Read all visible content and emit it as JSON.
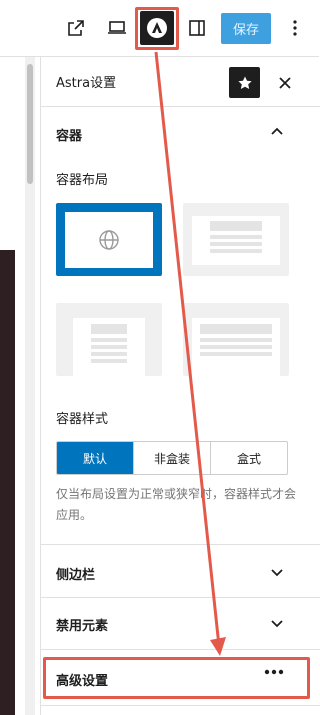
{
  "toolbar": {
    "icons": [
      "external-link-icon",
      "laptop-icon",
      "astra-logo-icon",
      "sidebar-toggle-icon",
      "more-vertical-icon"
    ],
    "save_label": "保存"
  },
  "sidebar": {
    "title": "Astra设置",
    "container": {
      "title": "容器",
      "layout_label": "容器布局",
      "style_label": "容器样式",
      "style_options": [
        "默认",
        "非盒装",
        "盒式"
      ],
      "selected_style": "默认",
      "help_text": "仅当布局设置为正常或狭窄时，容器样式才会应用。"
    },
    "sidebar_section": "侧边栏",
    "disable_elements": "禁用元素",
    "advanced": "高级设置"
  },
  "colors": {
    "accent": "#0075be",
    "save_bg": "#3fa0e0",
    "highlight": "#e35a4b",
    "dark": "#1e1e1e"
  }
}
